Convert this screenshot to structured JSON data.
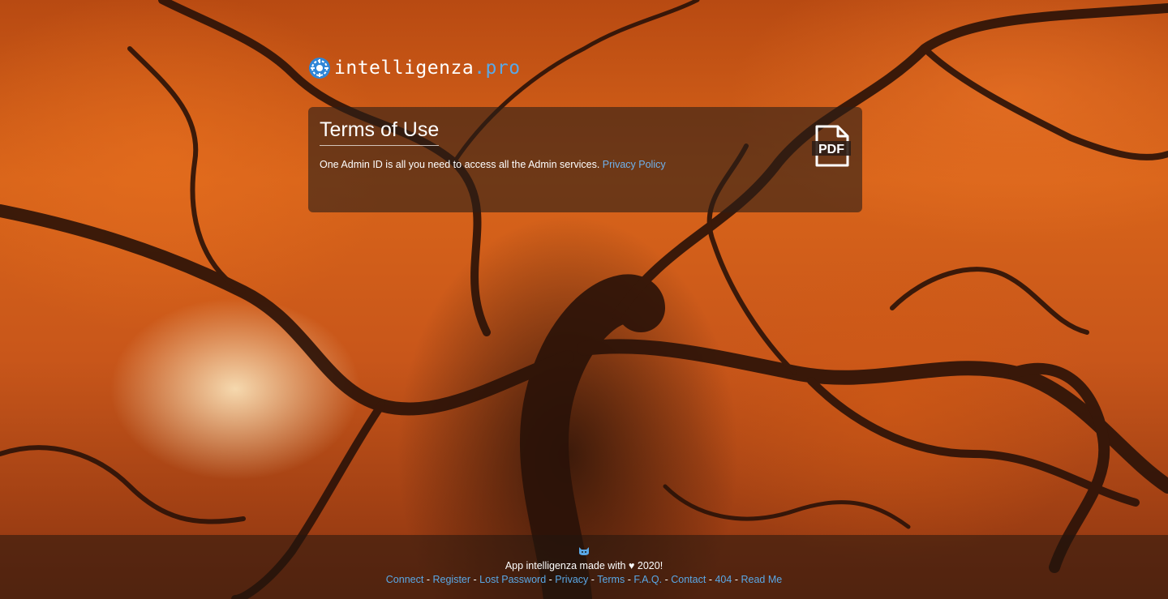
{
  "brand": {
    "name": "intelligenza",
    "tld": ".pro",
    "logo_icon": "gear-logo-icon"
  },
  "terms": {
    "title": "Terms of Use",
    "text": "One Admin ID is all you need to access all the Admin services.",
    "privacy_link": "Privacy Policy",
    "document_icon": "pdf-icon"
  },
  "footer": {
    "icon": "cat-icon",
    "made_prefix": "App intelligenza made with",
    "heart_icon": "heart-icon",
    "year": "2020!",
    "links": {
      "connect": "Connect",
      "register": "Register",
      "lost_password": "Lost Password",
      "privacy": "Privacy",
      "terms": "Terms",
      "faq": "F.A.Q.",
      "contact": "Contact",
      "not_found": "404",
      "read_me": "Read Me"
    },
    "separator": "-"
  },
  "colors": {
    "link": "#5aa8e6",
    "card_bg": "#2d1e16",
    "text": "#ffffff"
  }
}
